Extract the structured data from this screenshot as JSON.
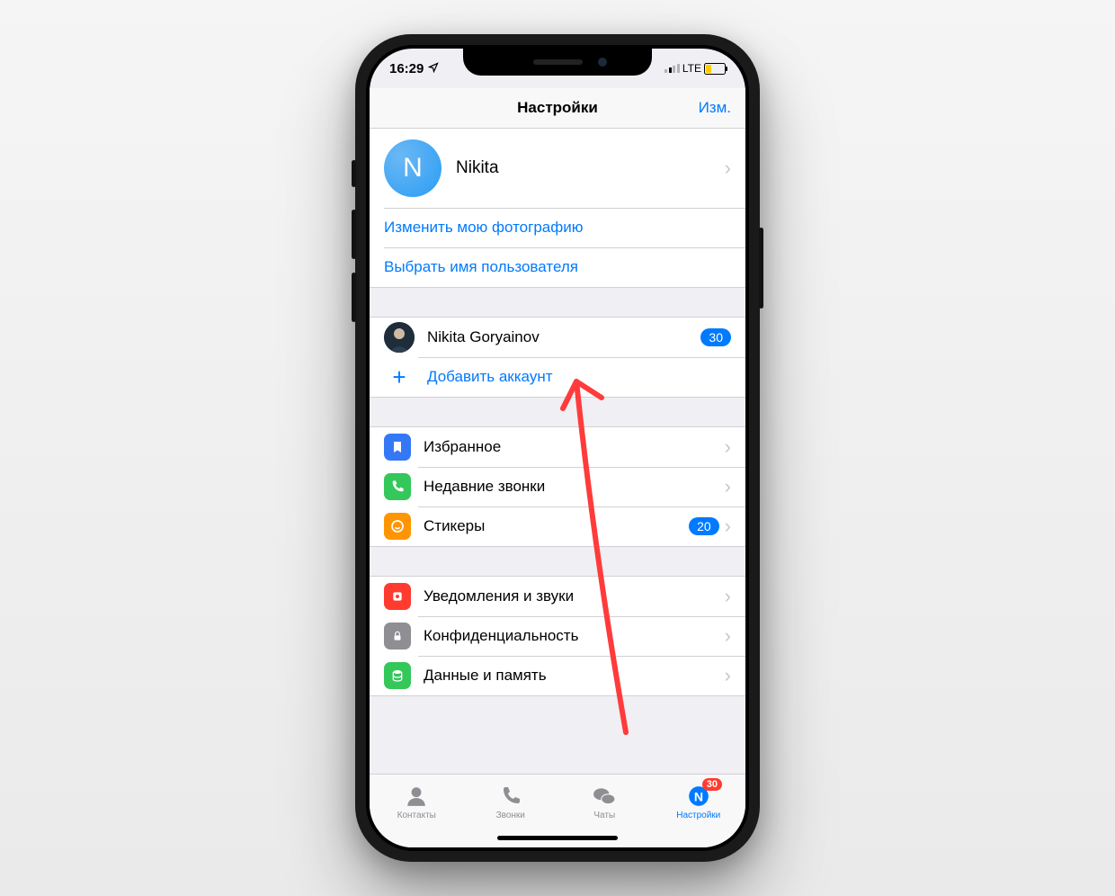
{
  "statusbar": {
    "time": "16:29",
    "carrier": "LTE"
  },
  "navbar": {
    "title": "Настройки",
    "right": "Изм."
  },
  "profile": {
    "initial": "N",
    "name": "Nikita",
    "change_photo": "Изменить мою фотографию",
    "choose_username": "Выбрать имя пользователя"
  },
  "accounts": {
    "other_name": "Nikita Goryainov",
    "other_badge": "30",
    "add_account": "Добавить аккаунт"
  },
  "menu": {
    "saved": "Избранное",
    "recent_calls": "Недавние звонки",
    "stickers": "Стикеры",
    "stickers_badge": "20",
    "notifications": "Уведомления и звуки",
    "privacy": "Конфиденциальность",
    "data": "Данные и память"
  },
  "tabs": {
    "contacts": "Контакты",
    "calls": "Звонки",
    "chats": "Чаты",
    "settings": "Настройки",
    "settings_badge": "30"
  }
}
